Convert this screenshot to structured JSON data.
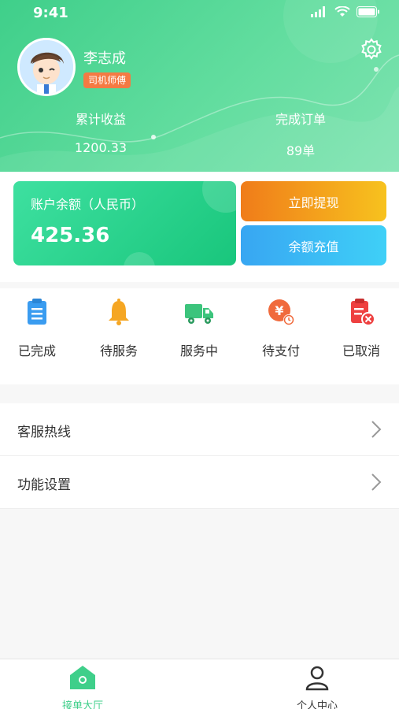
{
  "status_bar": {
    "time": "9:41"
  },
  "profile": {
    "name": "李志成",
    "role": "司机师傅"
  },
  "stats": {
    "income_label": "累计收益",
    "income_value": "1200.33",
    "orders_label": "完成订单",
    "orders_value": "89单"
  },
  "balance": {
    "label": "账户余额（人民币）",
    "amount": "425.36",
    "withdraw_label": "立即提现",
    "recharge_label": "余额充值"
  },
  "order_status": [
    {
      "label": "已完成",
      "icon": "clipboard-icon",
      "color": "#3a9cf0"
    },
    {
      "label": "待服务",
      "icon": "bell-icon",
      "color": "#f5a623"
    },
    {
      "label": "服务中",
      "icon": "truck-icon",
      "color": "#3cc47c"
    },
    {
      "label": "待支付",
      "icon": "yuan-coin-icon",
      "color": "#f06a3c"
    },
    {
      "label": "已取消",
      "icon": "cancel-clipboard-icon",
      "color": "#ee4040"
    }
  ],
  "menu": [
    {
      "label": "客服热线"
    },
    {
      "label": "功能设置"
    }
  ],
  "tabbar": [
    {
      "label": "接单大厅",
      "active": true
    },
    {
      "label": "个人中心",
      "active": false
    }
  ],
  "colors": {
    "brand_green": "#3fcf8a",
    "badge_orange": "#f47a43"
  }
}
